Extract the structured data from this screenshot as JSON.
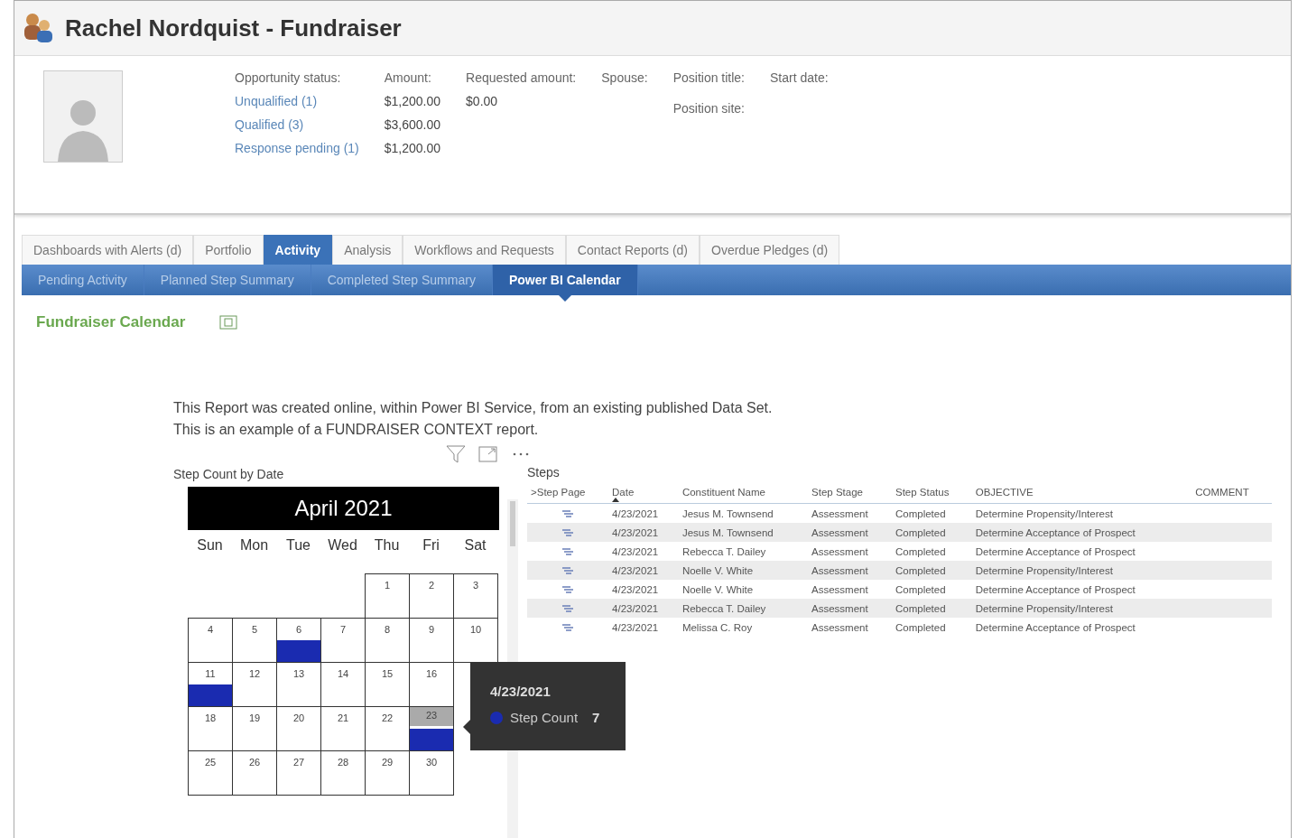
{
  "header": {
    "title": "Rachel Nordquist - Fundraiser"
  },
  "summary": {
    "opportunity": {
      "label": "Opportunity status:",
      "links": [
        "Unqualified (1)",
        "Qualified (3)",
        "Response pending (1)"
      ]
    },
    "amount": {
      "label": "Amount:",
      "values": [
        "$1,200.00",
        "$3,600.00",
        "$1,200.00"
      ]
    },
    "requested": {
      "label": "Requested amount:",
      "values": [
        "$0.00"
      ]
    },
    "spouse": {
      "label": "Spouse:"
    },
    "position": {
      "labels": [
        "Position title:",
        "Position site:"
      ]
    },
    "start": {
      "label": "Start date:"
    }
  },
  "tabs": [
    {
      "label": "Dashboards with Alerts (d)",
      "selected": false
    },
    {
      "label": "Portfolio",
      "selected": false
    },
    {
      "label": "Activity",
      "selected": true
    },
    {
      "label": "Analysis",
      "selected": false
    },
    {
      "label": "Workflows and Requests",
      "selected": false
    },
    {
      "label": "Contact Reports (d)",
      "selected": false
    },
    {
      "label": "Overdue Pledges (d)",
      "selected": false
    }
  ],
  "subtabs": [
    {
      "label": "Pending Activity",
      "selected": false
    },
    {
      "label": "Planned Step Summary",
      "selected": false
    },
    {
      "label": "Completed Step Summary",
      "selected": false
    },
    {
      "label": "Power BI Calendar",
      "selected": true
    }
  ],
  "section_title": "Fundraiser Calendar",
  "intro": [
    "This Report was created online, within Power BI Service, from an existing published Data Set.",
    "This is an example of a FUNDRAISER CONTEXT report."
  ],
  "calendar": {
    "title": "Step Count by Date",
    "month": "April 2021",
    "weekdays": [
      "Sun",
      "Mon",
      "Tue",
      "Wed",
      "Thu",
      "Fri",
      "Sat"
    ],
    "days": [
      {
        "day": "1",
        "has_steps": false,
        "selected": false
      },
      {
        "day": "2",
        "has_steps": false,
        "selected": false
      },
      {
        "day": "3",
        "has_steps": false,
        "selected": false
      },
      {
        "day": "4",
        "has_steps": false,
        "selected": false
      },
      {
        "day": "5",
        "has_steps": false,
        "selected": false
      },
      {
        "day": "6",
        "has_steps": true,
        "selected": false
      },
      {
        "day": "7",
        "has_steps": false,
        "selected": false
      },
      {
        "day": "8",
        "has_steps": false,
        "selected": false
      },
      {
        "day": "9",
        "has_steps": false,
        "selected": false
      },
      {
        "day": "10",
        "has_steps": false,
        "selected": false
      },
      {
        "day": "11",
        "has_steps": true,
        "selected": false
      },
      {
        "day": "12",
        "has_steps": false,
        "selected": false
      },
      {
        "day": "13",
        "has_steps": false,
        "selected": false
      },
      {
        "day": "14",
        "has_steps": false,
        "selected": false
      },
      {
        "day": "15",
        "has_steps": false,
        "selected": false
      },
      {
        "day": "16",
        "has_steps": false,
        "selected": false
      },
      {
        "day": "18",
        "has_steps": false,
        "selected": false
      },
      {
        "day": "19",
        "has_steps": false,
        "selected": false
      },
      {
        "day": "20",
        "has_steps": false,
        "selected": false
      },
      {
        "day": "21",
        "has_steps": false,
        "selected": false
      },
      {
        "day": "22",
        "has_steps": false,
        "selected": false
      },
      {
        "day": "23",
        "has_steps": true,
        "selected": true
      },
      {
        "day": "25",
        "has_steps": false,
        "selected": false
      },
      {
        "day": "26",
        "has_steps": false,
        "selected": false
      },
      {
        "day": "27",
        "has_steps": false,
        "selected": false
      },
      {
        "day": "28",
        "has_steps": false,
        "selected": false
      },
      {
        "day": "29",
        "has_steps": false,
        "selected": false
      },
      {
        "day": "30",
        "has_steps": false,
        "selected": false
      }
    ],
    "tooltip": {
      "date": "4/23/2021",
      "label": "Step Count",
      "value": "7",
      "color": "#1a2bb0"
    }
  },
  "steps": {
    "title": "Steps",
    "columns": [
      ">Step Page",
      "Date",
      "Constituent Name",
      "Step Stage",
      "Step Status",
      "OBJECTIVE",
      "COMMENT"
    ],
    "rows": [
      [
        "",
        "4/23/2021",
        "Jesus M. Townsend",
        "Assessment",
        "Completed",
        "Determine Propensity/Interest"
      ],
      [
        "",
        "4/23/2021",
        "Jesus M. Townsend",
        "Assessment",
        "Completed",
        "Determine Acceptance of Prospect"
      ],
      [
        "",
        "4/23/2021",
        "Rebecca T. Dailey",
        "Assessment",
        "Completed",
        "Determine Acceptance of Prospect"
      ],
      [
        "",
        "4/23/2021",
        "Noelle V. White",
        "Assessment",
        "Completed",
        "Determine Propensity/Interest"
      ],
      [
        "",
        "4/23/2021",
        "Noelle V. White",
        "Assessment",
        "Completed",
        "Determine Acceptance of Prospect"
      ],
      [
        "",
        "4/23/2021",
        "Rebecca T. Dailey",
        "Assessment",
        "Completed",
        "Determine Propensity/Interest"
      ],
      [
        "",
        "4/23/2021",
        "Melissa C. Roy",
        "Assessment",
        "Completed",
        "Determine Acceptance of Prospect"
      ]
    ]
  }
}
